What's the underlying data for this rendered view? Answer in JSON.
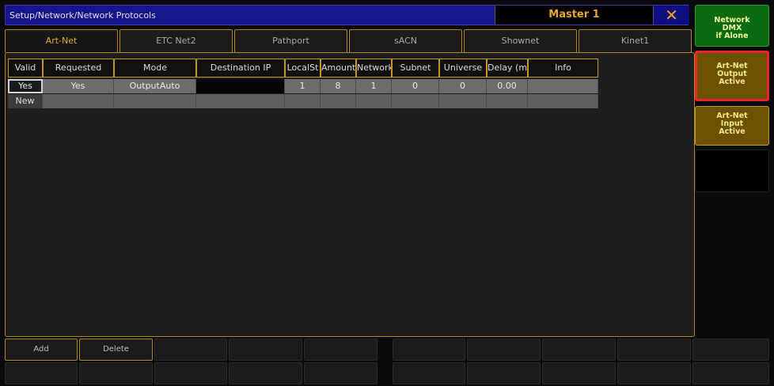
{
  "titlebar": {
    "path": "Setup/Network/Network Protocols",
    "master": "Master 1",
    "close_icon": "close-x-icon"
  },
  "tabs": [
    {
      "label": "Art-Net",
      "active": true
    },
    {
      "label": "ETC Net2",
      "active": false
    },
    {
      "label": "Pathport",
      "active": false
    },
    {
      "label": "sACN",
      "active": false
    },
    {
      "label": "Shownet",
      "active": false
    },
    {
      "label": "Kinet1",
      "active": false
    }
  ],
  "table": {
    "columns": [
      "Valid",
      "Requested",
      "Mode",
      "Destination IP",
      "LocalSt",
      "Amount",
      "Network",
      "Subnet",
      "Universe",
      "Delay (ms",
      "Info"
    ],
    "rows": [
      {
        "valid": "Yes",
        "requested": "Yes",
        "mode": "OutputAuto",
        "destination_ip": "",
        "localst": "1",
        "amount": "8",
        "network": "1",
        "subnet": "0",
        "universe": "0",
        "delay": "0.00",
        "info": ""
      },
      {
        "valid": "New",
        "requested": "",
        "mode": "",
        "destination_ip": "",
        "localst": "",
        "amount": "",
        "network": "",
        "subnet": "",
        "universe": "",
        "delay": "",
        "info": ""
      }
    ]
  },
  "side_panel": {
    "network_dmx": "Network\nDMX\nif Alone",
    "artnet_output": "Art-Net\nOutput\nActive",
    "artnet_input": "Art-Net\nInput\nActive"
  },
  "bottom": {
    "add_label": "Add",
    "delete_label": "Delete"
  },
  "colors": {
    "accent": "#c79620",
    "title_bar": "#16168c",
    "active_green": "#0c6a10",
    "active_amber": "#6b5200",
    "highlight_red": "#e3262f"
  }
}
